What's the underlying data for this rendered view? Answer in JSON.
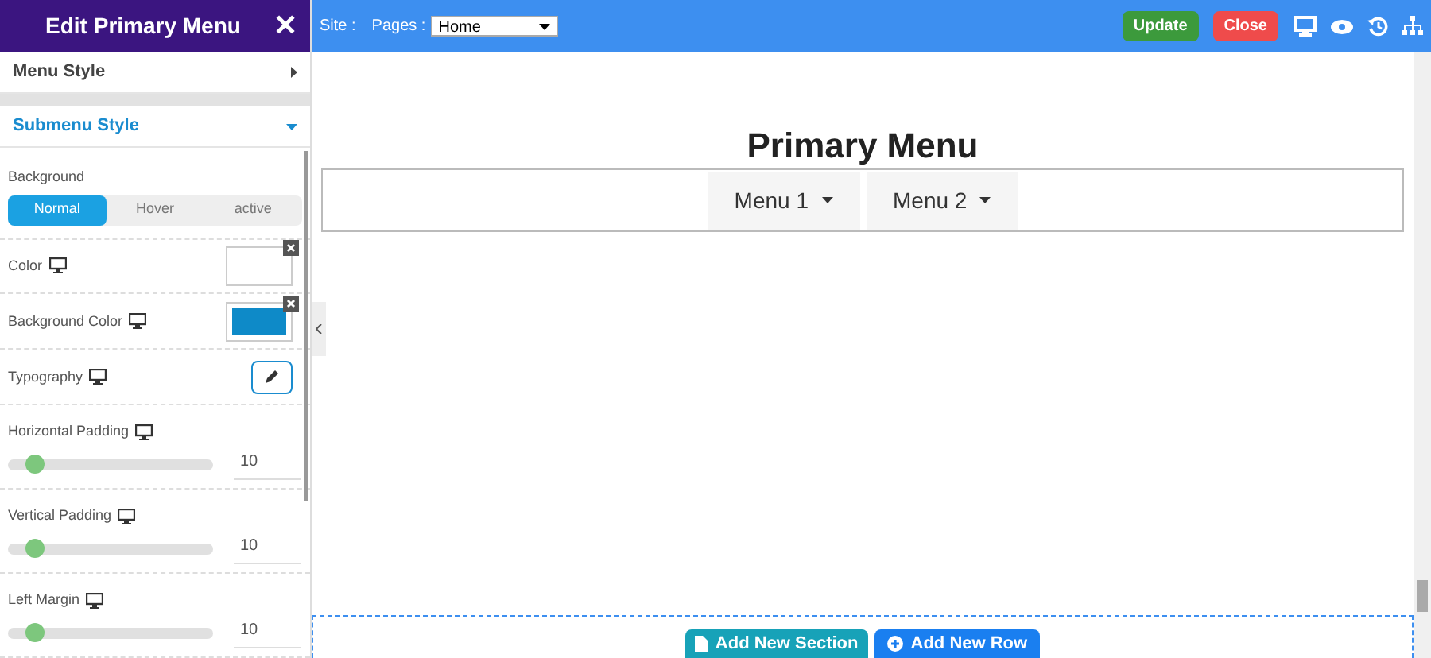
{
  "sidebar": {
    "title": "Edit Primary Menu",
    "close": "✕",
    "sections": [
      {
        "label": "Menu Style",
        "expanded": false
      },
      {
        "label": "Submenu Style",
        "expanded": true
      }
    ],
    "background": {
      "label": "Background",
      "tabs": [
        {
          "label": "Normal",
          "selected": true
        },
        {
          "label": "Hover",
          "selected": false
        },
        {
          "label": "active",
          "selected": false
        }
      ]
    },
    "fields": [
      {
        "kind": "color",
        "label": "Color",
        "color": "#ffffff"
      },
      {
        "kind": "color",
        "label": "Background Color",
        "color": "#0e8ac8"
      },
      {
        "kind": "edit",
        "label": "Typography"
      },
      {
        "kind": "slider",
        "label": "Horizontal Padding",
        "level": 0.13,
        "value": "10"
      },
      {
        "kind": "slider",
        "label": "Vertical Padding",
        "level": 0.13,
        "value": "10"
      },
      {
        "kind": "slider",
        "label": "Left Margin",
        "level": 0.13,
        "value": "10"
      }
    ]
  },
  "toolbar": {
    "site": "Site :",
    "pages_label": "Pages :",
    "pages_value": "Home",
    "update": "Update",
    "close": "Close"
  },
  "canvas": {
    "title": "Primary Menu",
    "menu_items": [
      "Menu 1",
      "Menu 2"
    ],
    "add_section": "Add New Section",
    "add_row": "Add New Row"
  }
}
